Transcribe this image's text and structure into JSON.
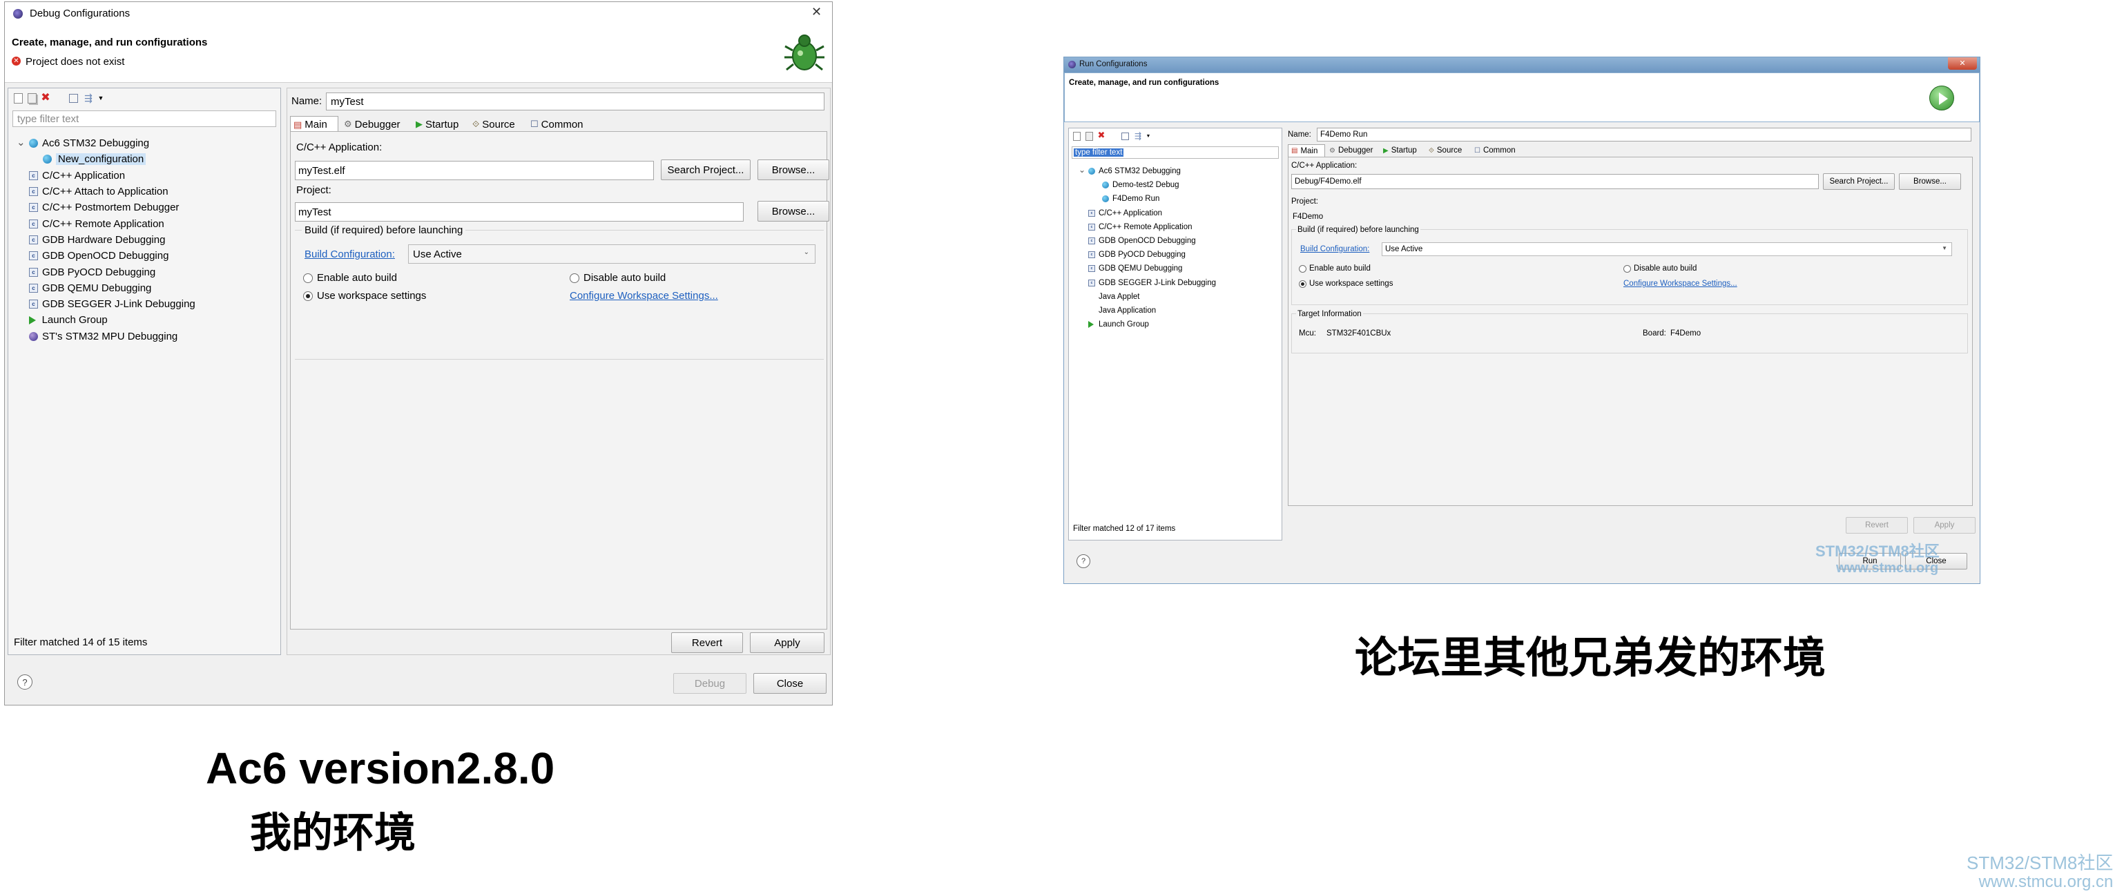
{
  "left_dialog": {
    "title": "Debug Configurations",
    "close_glyph": "✕",
    "header_title": "Create, manage, and run configurations",
    "error_message": "Project does not exist",
    "filter_placeholder": "type filter text",
    "tree": [
      {
        "label": "Ac6 STM32 Debugging",
        "icon": "debug-icon",
        "expanded": true
      },
      {
        "label": "New_configuration",
        "icon": "debug-icon",
        "child": true,
        "selected": true
      },
      {
        "label": "C/C++ Application",
        "icon": "c-icon"
      },
      {
        "label": "C/C++ Attach to Application",
        "icon": "c-icon"
      },
      {
        "label": "C/C++ Postmortem Debugger",
        "icon": "c-icon"
      },
      {
        "label": "C/C++ Remote Application",
        "icon": "c-icon"
      },
      {
        "label": "GDB Hardware Debugging",
        "icon": "c-icon"
      },
      {
        "label": "GDB OpenOCD Debugging",
        "icon": "c-icon"
      },
      {
        "label": "GDB PyOCD Debugging",
        "icon": "c-icon"
      },
      {
        "label": "GDB QEMU Debugging",
        "icon": "c-icon"
      },
      {
        "label": "GDB SEGGER J-Link Debugging",
        "icon": "c-icon"
      },
      {
        "label": "Launch Group",
        "icon": "launch-icon"
      },
      {
        "label": "ST's STM32 MPU Debugging",
        "icon": "st-icon"
      }
    ],
    "filter_status": "Filter matched 14 of 15 items",
    "name_label": "Name:",
    "name_value": "myTest",
    "tabs": [
      "Main",
      "Debugger",
      "Startup",
      "Source",
      "Common"
    ],
    "app_label": "C/C++ Application:",
    "app_value": "myTest.elf",
    "search_project": "Search Project...",
    "browse": "Browse...",
    "project_label": "Project:",
    "project_value": "myTest",
    "build_group": "Build (if required) before launching",
    "build_config_link": "Build Configuration:",
    "build_config_value": "Use Active",
    "enable_auto": "Enable auto build",
    "disable_auto": "Disable auto build",
    "use_workspace": "Use workspace settings",
    "configure_link": "Configure Workspace Settings...",
    "revert": "Revert",
    "apply": "Apply",
    "debug": "Debug",
    "close": "Close",
    "help": "?"
  },
  "left_caption": {
    "line1": "Ac6 version2.8.0",
    "line2": "我的环境"
  },
  "right_dialog": {
    "title": "Run Configurations",
    "close_glyph": "✕",
    "header_title": "Create, manage, and run configurations",
    "filter_placeholder": "type filter text",
    "tree": [
      {
        "label": "Ac6 STM32 Debugging",
        "icon": "debug-icon",
        "expanded": true
      },
      {
        "label": "Demo-test2 Debug",
        "icon": "debug-icon",
        "child": true
      },
      {
        "label": "F4Demo Run",
        "icon": "debug-icon",
        "child": true
      },
      {
        "label": "C/C++ Application",
        "icon": "c-icon"
      },
      {
        "label": "C/C++ Remote Application",
        "icon": "c-icon"
      },
      {
        "label": "GDB OpenOCD Debugging",
        "icon": "c-icon"
      },
      {
        "label": "GDB PyOCD Debugging",
        "icon": "c-icon"
      },
      {
        "label": "GDB QEMU Debugging",
        "icon": "c-icon"
      },
      {
        "label": "GDB SEGGER J-Link Debugging",
        "icon": "c-icon"
      },
      {
        "label": "Java Applet",
        "icon": "none"
      },
      {
        "label": "Java Application",
        "icon": "none"
      },
      {
        "label": "Launch Group",
        "icon": "launch-icon"
      }
    ],
    "filter_status": "Filter matched 12 of 17 items",
    "name_label": "Name:",
    "name_value": "F4Demo Run",
    "tabs": [
      "Main",
      "Debugger",
      "Startup",
      "Source",
      "Common"
    ],
    "app_label": "C/C++ Application:",
    "app_value": "Debug/F4Demo.elf",
    "search_project": "Search Project...",
    "browse": "Browse...",
    "project_label": "Project:",
    "project_value": "F4Demo",
    "build_group": "Build (if required) before launching",
    "build_config_link": "Build Configuration:",
    "build_config_value": "Use Active",
    "enable_auto": "Enable auto build",
    "disable_auto": "Disable auto build",
    "use_workspace": "Use workspace settings",
    "configure_link": "Configure Workspace Settings...",
    "target_group": "Target Information",
    "mcu_label": "Mcu:",
    "mcu_value": "STM32F401CBUx",
    "board_label": "Board:",
    "board_value": "F4Demo",
    "revert": "Revert",
    "apply": "Apply",
    "run": "Run",
    "close": "Close",
    "help": "?",
    "watermark_line1": "STM32/STM8社区",
    "watermark_line2": "www.stmcu.org"
  },
  "right_caption": "论坛里其他兄弟发的环境",
  "corner_watermark": {
    "line1": "STM32/STM8社区",
    "line2": "www.stmcu.org.cn"
  },
  "colors": {
    "accent_link": "#1d5fbf",
    "selection": "#cde3f7",
    "error": "#d93025",
    "watermark": "#9cc3dc"
  }
}
